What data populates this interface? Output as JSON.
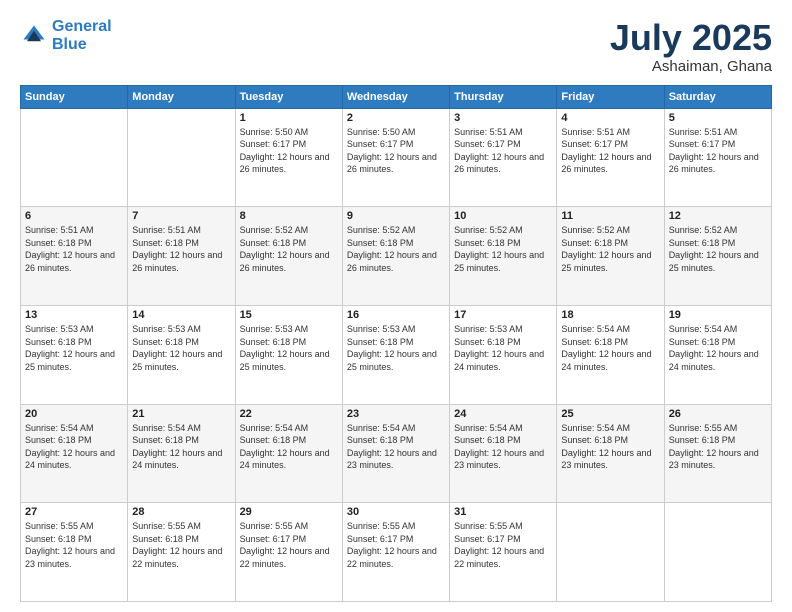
{
  "logo": {
    "line1": "General",
    "line2": "Blue"
  },
  "title": "July 2025",
  "subtitle": "Ashaiman, Ghana",
  "weekdays": [
    "Sunday",
    "Monday",
    "Tuesday",
    "Wednesday",
    "Thursday",
    "Friday",
    "Saturday"
  ],
  "weeks": [
    [
      {
        "day": "",
        "sunrise": "",
        "sunset": "",
        "daylight": ""
      },
      {
        "day": "",
        "sunrise": "",
        "sunset": "",
        "daylight": ""
      },
      {
        "day": "1",
        "sunrise": "Sunrise: 5:50 AM",
        "sunset": "Sunset: 6:17 PM",
        "daylight": "Daylight: 12 hours and 26 minutes."
      },
      {
        "day": "2",
        "sunrise": "Sunrise: 5:50 AM",
        "sunset": "Sunset: 6:17 PM",
        "daylight": "Daylight: 12 hours and 26 minutes."
      },
      {
        "day": "3",
        "sunrise": "Sunrise: 5:51 AM",
        "sunset": "Sunset: 6:17 PM",
        "daylight": "Daylight: 12 hours and 26 minutes."
      },
      {
        "day": "4",
        "sunrise": "Sunrise: 5:51 AM",
        "sunset": "Sunset: 6:17 PM",
        "daylight": "Daylight: 12 hours and 26 minutes."
      },
      {
        "day": "5",
        "sunrise": "Sunrise: 5:51 AM",
        "sunset": "Sunset: 6:17 PM",
        "daylight": "Daylight: 12 hours and 26 minutes."
      }
    ],
    [
      {
        "day": "6",
        "sunrise": "Sunrise: 5:51 AM",
        "sunset": "Sunset: 6:18 PM",
        "daylight": "Daylight: 12 hours and 26 minutes."
      },
      {
        "day": "7",
        "sunrise": "Sunrise: 5:51 AM",
        "sunset": "Sunset: 6:18 PM",
        "daylight": "Daylight: 12 hours and 26 minutes."
      },
      {
        "day": "8",
        "sunrise": "Sunrise: 5:52 AM",
        "sunset": "Sunset: 6:18 PM",
        "daylight": "Daylight: 12 hours and 26 minutes."
      },
      {
        "day": "9",
        "sunrise": "Sunrise: 5:52 AM",
        "sunset": "Sunset: 6:18 PM",
        "daylight": "Daylight: 12 hours and 26 minutes."
      },
      {
        "day": "10",
        "sunrise": "Sunrise: 5:52 AM",
        "sunset": "Sunset: 6:18 PM",
        "daylight": "Daylight: 12 hours and 25 minutes."
      },
      {
        "day": "11",
        "sunrise": "Sunrise: 5:52 AM",
        "sunset": "Sunset: 6:18 PM",
        "daylight": "Daylight: 12 hours and 25 minutes."
      },
      {
        "day": "12",
        "sunrise": "Sunrise: 5:52 AM",
        "sunset": "Sunset: 6:18 PM",
        "daylight": "Daylight: 12 hours and 25 minutes."
      }
    ],
    [
      {
        "day": "13",
        "sunrise": "Sunrise: 5:53 AM",
        "sunset": "Sunset: 6:18 PM",
        "daylight": "Daylight: 12 hours and 25 minutes."
      },
      {
        "day": "14",
        "sunrise": "Sunrise: 5:53 AM",
        "sunset": "Sunset: 6:18 PM",
        "daylight": "Daylight: 12 hours and 25 minutes."
      },
      {
        "day": "15",
        "sunrise": "Sunrise: 5:53 AM",
        "sunset": "Sunset: 6:18 PM",
        "daylight": "Daylight: 12 hours and 25 minutes."
      },
      {
        "day": "16",
        "sunrise": "Sunrise: 5:53 AM",
        "sunset": "Sunset: 6:18 PM",
        "daylight": "Daylight: 12 hours and 25 minutes."
      },
      {
        "day": "17",
        "sunrise": "Sunrise: 5:53 AM",
        "sunset": "Sunset: 6:18 PM",
        "daylight": "Daylight: 12 hours and 24 minutes."
      },
      {
        "day": "18",
        "sunrise": "Sunrise: 5:54 AM",
        "sunset": "Sunset: 6:18 PM",
        "daylight": "Daylight: 12 hours and 24 minutes."
      },
      {
        "day": "19",
        "sunrise": "Sunrise: 5:54 AM",
        "sunset": "Sunset: 6:18 PM",
        "daylight": "Daylight: 12 hours and 24 minutes."
      }
    ],
    [
      {
        "day": "20",
        "sunrise": "Sunrise: 5:54 AM",
        "sunset": "Sunset: 6:18 PM",
        "daylight": "Daylight: 12 hours and 24 minutes."
      },
      {
        "day": "21",
        "sunrise": "Sunrise: 5:54 AM",
        "sunset": "Sunset: 6:18 PM",
        "daylight": "Daylight: 12 hours and 24 minutes."
      },
      {
        "day": "22",
        "sunrise": "Sunrise: 5:54 AM",
        "sunset": "Sunset: 6:18 PM",
        "daylight": "Daylight: 12 hours and 24 minutes."
      },
      {
        "day": "23",
        "sunrise": "Sunrise: 5:54 AM",
        "sunset": "Sunset: 6:18 PM",
        "daylight": "Daylight: 12 hours and 23 minutes."
      },
      {
        "day": "24",
        "sunrise": "Sunrise: 5:54 AM",
        "sunset": "Sunset: 6:18 PM",
        "daylight": "Daylight: 12 hours and 23 minutes."
      },
      {
        "day": "25",
        "sunrise": "Sunrise: 5:54 AM",
        "sunset": "Sunset: 6:18 PM",
        "daylight": "Daylight: 12 hours and 23 minutes."
      },
      {
        "day": "26",
        "sunrise": "Sunrise: 5:55 AM",
        "sunset": "Sunset: 6:18 PM",
        "daylight": "Daylight: 12 hours and 23 minutes."
      }
    ],
    [
      {
        "day": "27",
        "sunrise": "Sunrise: 5:55 AM",
        "sunset": "Sunset: 6:18 PM",
        "daylight": "Daylight: 12 hours and 23 minutes."
      },
      {
        "day": "28",
        "sunrise": "Sunrise: 5:55 AM",
        "sunset": "Sunset: 6:18 PM",
        "daylight": "Daylight: 12 hours and 22 minutes."
      },
      {
        "day": "29",
        "sunrise": "Sunrise: 5:55 AM",
        "sunset": "Sunset: 6:17 PM",
        "daylight": "Daylight: 12 hours and 22 minutes."
      },
      {
        "day": "30",
        "sunrise": "Sunrise: 5:55 AM",
        "sunset": "Sunset: 6:17 PM",
        "daylight": "Daylight: 12 hours and 22 minutes."
      },
      {
        "day": "31",
        "sunrise": "Sunrise: 5:55 AM",
        "sunset": "Sunset: 6:17 PM",
        "daylight": "Daylight: 12 hours and 22 minutes."
      },
      {
        "day": "",
        "sunrise": "",
        "sunset": "",
        "daylight": ""
      },
      {
        "day": "",
        "sunrise": "",
        "sunset": "",
        "daylight": ""
      }
    ]
  ]
}
